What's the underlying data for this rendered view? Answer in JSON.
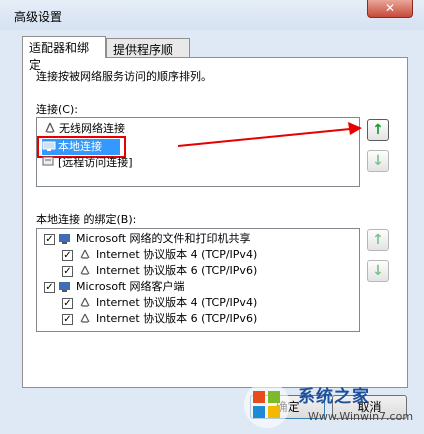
{
  "window": {
    "title": "高级设置",
    "close_label": "✕"
  },
  "tabs": [
    {
      "label": "适配器和绑定"
    },
    {
      "label": "提供程序顺序"
    }
  ],
  "description": "连接按被网络服务访问的顺序排列。",
  "connections": {
    "label": "连接(C):",
    "items": [
      {
        "label": "无线网络连接"
      },
      {
        "label": "本地连接"
      },
      {
        "label": "[远程访问连接]"
      }
    ]
  },
  "bindings": {
    "label": "本地连接 的绑定(B):",
    "items": [
      {
        "label": "Microsoft 网络的文件和打印机共享"
      },
      {
        "label": "Internet 协议版本 4 (TCP/IPv4)"
      },
      {
        "label": "Internet 协议版本 6 (TCP/IPv6)"
      },
      {
        "label": "Microsoft 网络客户端"
      },
      {
        "label": "Internet 协议版本 4 (TCP/IPv4)"
      },
      {
        "label": "Internet 协议版本 6 (TCP/IPv6)"
      }
    ]
  },
  "buttons": {
    "ok": "确定",
    "cancel": "取消"
  },
  "watermark": {
    "text": "系统之家",
    "url": "Www.Winwin7.com"
  },
  "colors": {
    "selection": "#3399ff",
    "annotation": "#e60000",
    "arrow_green": "#149c2c"
  }
}
